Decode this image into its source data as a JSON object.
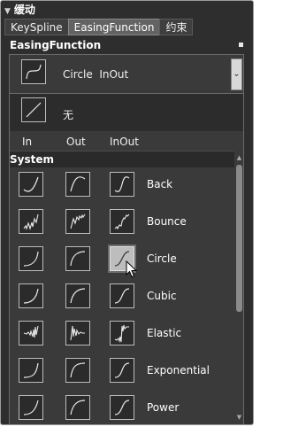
{
  "header": {
    "title": "缓动"
  },
  "tabs": [
    "KeySpline",
    "EasingFunction",
    "约束"
  ],
  "section": {
    "title": "EasingFunction"
  },
  "combo": {
    "mode": "Circle",
    "variant": "InOut"
  },
  "none_label": "无",
  "columns": [
    "In",
    "Out",
    "InOut"
  ],
  "group_label": "System",
  "easing_functions": [
    "Back",
    "Bounce",
    "Circle",
    "Cubic",
    "Elastic",
    "Exponential",
    "Power"
  ],
  "selected": {
    "name": "Circle",
    "variant": "InOut"
  },
  "colors": {
    "panel": "#2e2e2e",
    "accent_selected": "#bdbdbd",
    "text": "#ffffff"
  }
}
